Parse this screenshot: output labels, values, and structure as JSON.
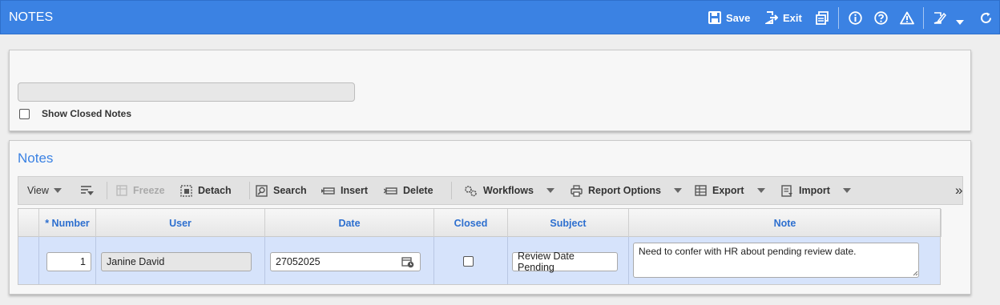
{
  "header": {
    "title": "NOTES",
    "save_label": "Save",
    "exit_label": "Exit"
  },
  "filter": {
    "show_closed_label": "Show Closed Notes",
    "show_closed_checked": false
  },
  "notes_section": {
    "title": "Notes",
    "toolbar": {
      "view": "View",
      "freeze": "Freeze",
      "detach": "Detach",
      "search": "Search",
      "insert": "Insert",
      "delete": "Delete",
      "workflows": "Workflows",
      "report_options": "Report Options",
      "export": "Export",
      "import": "Import",
      "more": "»"
    },
    "columns": [
      "* Number",
      "User",
      "Date",
      "Closed",
      "Subject",
      "Note"
    ],
    "rows": [
      {
        "number": "1",
        "user": "Janine David",
        "date": "27052025",
        "closed": false,
        "subject": "Review Date Pending",
        "note": "Need to confer with HR about pending review date."
      }
    ]
  },
  "colors": {
    "header_bg": "#3b82e3",
    "accent": "#2d6fcf",
    "selected_row": "#d6e3fb"
  }
}
